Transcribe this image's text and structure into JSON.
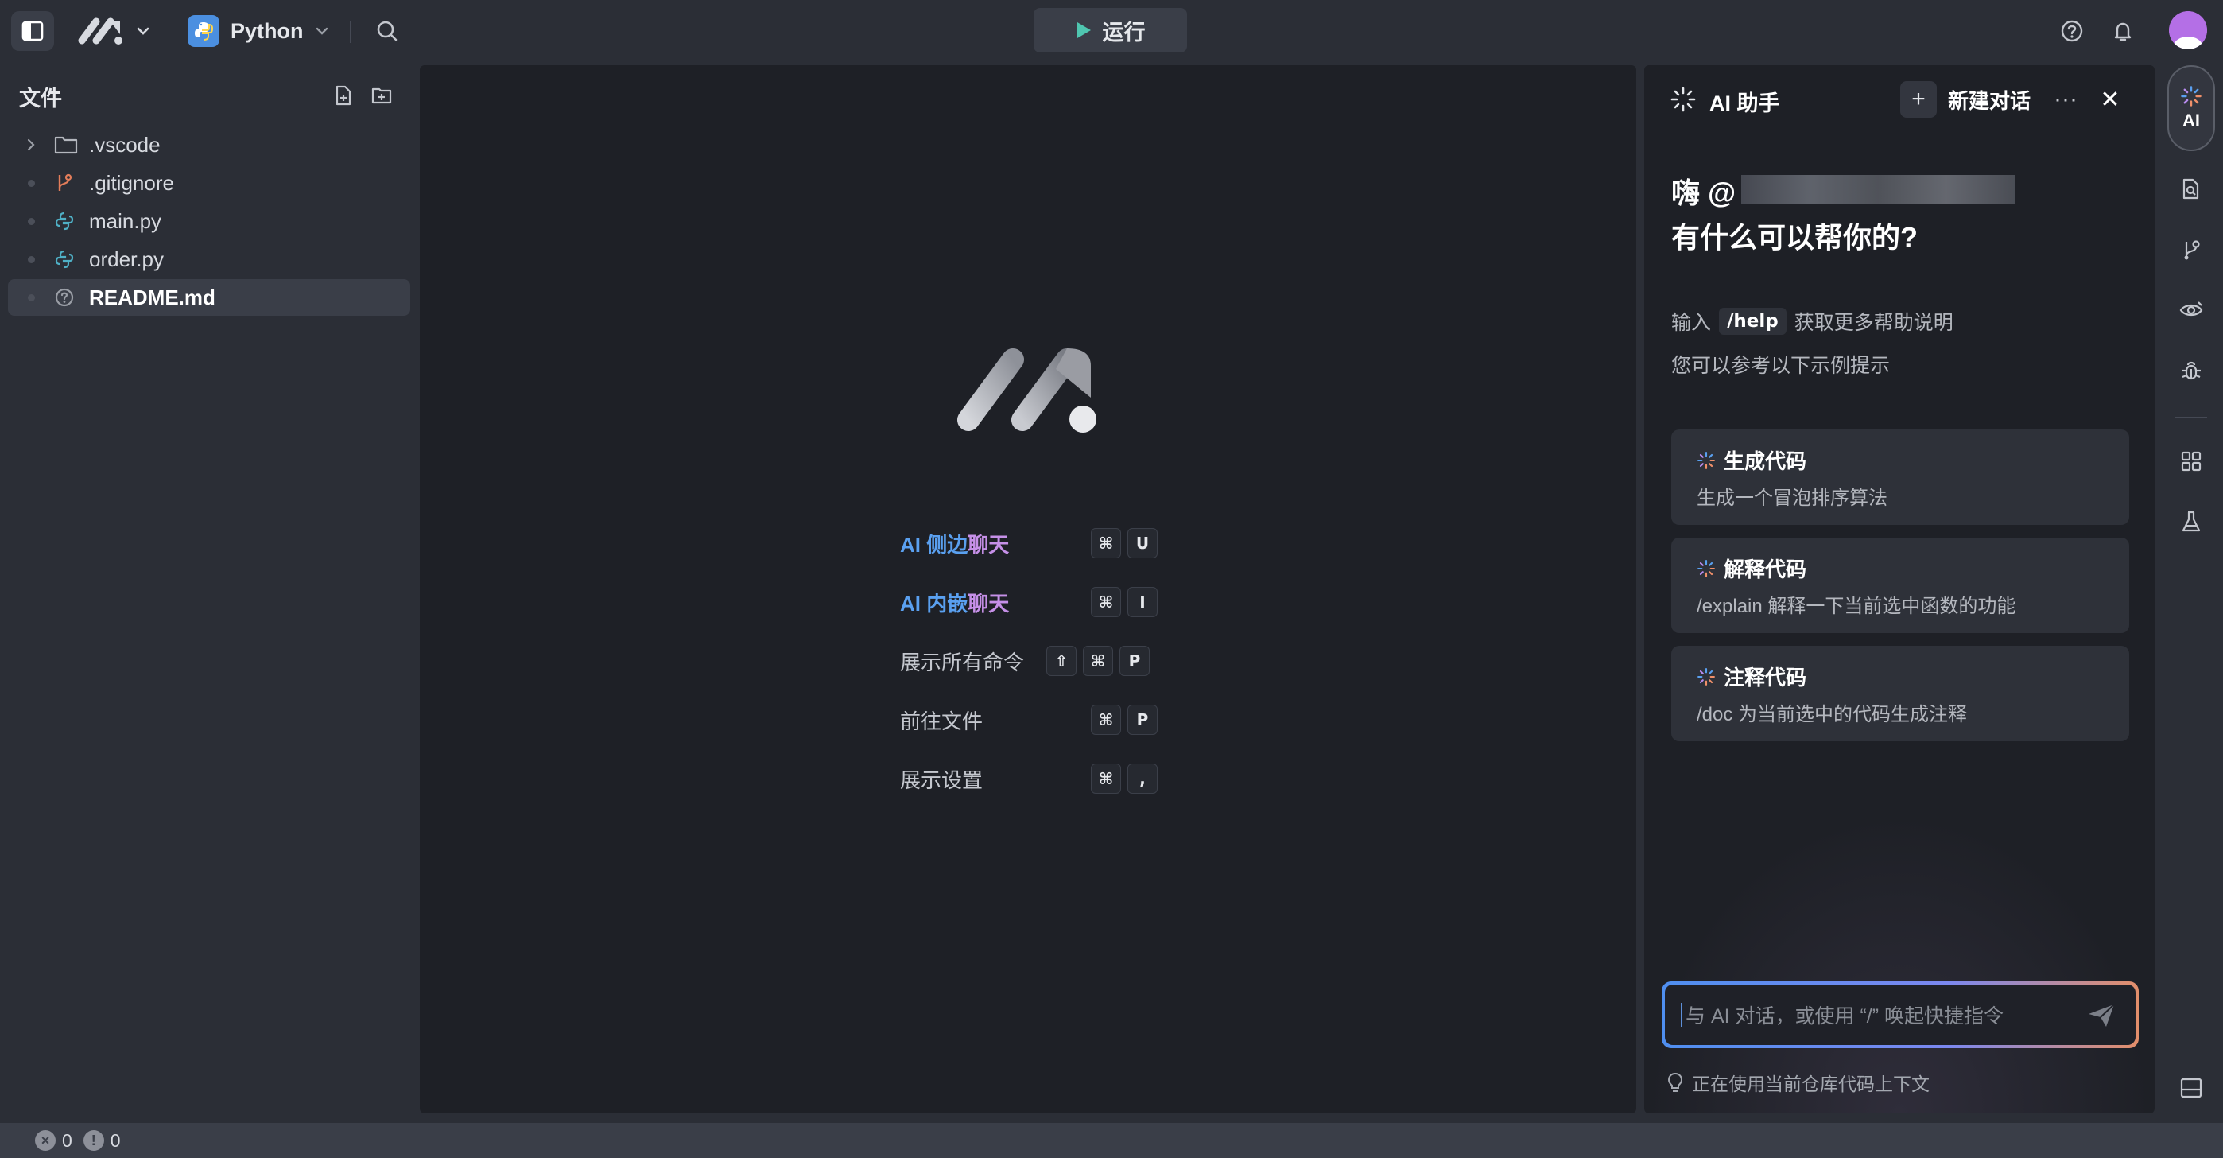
{
  "topbar": {
    "language": "Python",
    "run_label": "运行",
    "icons": [
      "sidebar-toggle-icon",
      "app-logo-icon",
      "chevron-down-icon",
      "python-icon",
      "search-icon",
      "play-icon",
      "help-icon",
      "bell-icon",
      "avatar"
    ]
  },
  "files": {
    "title": "文件",
    "items": [
      {
        "name": ".vscode",
        "type": "folder"
      },
      {
        "name": ".gitignore",
        "type": "git"
      },
      {
        "name": "main.py",
        "type": "python"
      },
      {
        "name": "order.py",
        "type": "python"
      },
      {
        "name": "README.md",
        "type": "markdown",
        "selected": true
      }
    ]
  },
  "editor": {
    "shortcuts": [
      {
        "label_parts": [
          "AI",
          "侧边",
          "聊天"
        ],
        "keys": [
          "⌘",
          "U"
        ]
      },
      {
        "label_parts": [
          "AI",
          "内嵌",
          "聊天"
        ],
        "keys": [
          "⌘",
          "I"
        ]
      },
      {
        "label": "展示所有命令",
        "keys": [
          "⇧",
          "⌘",
          "P"
        ]
      },
      {
        "label": "前往文件",
        "keys": [
          "⌘",
          "P"
        ]
      },
      {
        "label": "展示设置",
        "keys": [
          "⌘",
          ","
        ]
      }
    ]
  },
  "ai_panel": {
    "title": "AI 助手",
    "new_chat_label": "新建对话",
    "more_label": "···",
    "close_label": "✕",
    "greeting_prefix": "嗨 @",
    "greeting_question": "有什么可以帮你的?",
    "hint_prefix": "输入",
    "hint_command": "/help",
    "hint_suffix": "获取更多帮助说明",
    "hint_line2": "您可以参考以下示例提示",
    "cards": [
      {
        "title": "生成代码",
        "desc": "生成一个冒泡排序算法"
      },
      {
        "title": "解释代码",
        "desc": "/explain 解释一下当前选中函数的功能"
      },
      {
        "title": "注释代码",
        "desc": "/doc 为当前选中的代码生成注释"
      }
    ],
    "input_placeholder": "与 AI 对话，或使用 “/” 唤起快捷指令",
    "context_note": "正在使用当前仓库代码上下文"
  },
  "activitybar": {
    "ai_label": "AI",
    "icons": [
      "ai-sparkle-icon",
      "file-search-icon",
      "git-branch-icon",
      "eye-icon",
      "bug-icon",
      "grid-icon",
      "flask-icon",
      "panel-bottom-icon"
    ]
  },
  "statusbar": {
    "errors": "0",
    "warnings": "0"
  },
  "colors": {
    "accent_blue": "#5d8fd8",
    "ai_blue": "#5aa0f0",
    "ai_orange": "#f0906a",
    "ai_purple": "#b88cf0",
    "python_badge": "#4b8fe0"
  }
}
